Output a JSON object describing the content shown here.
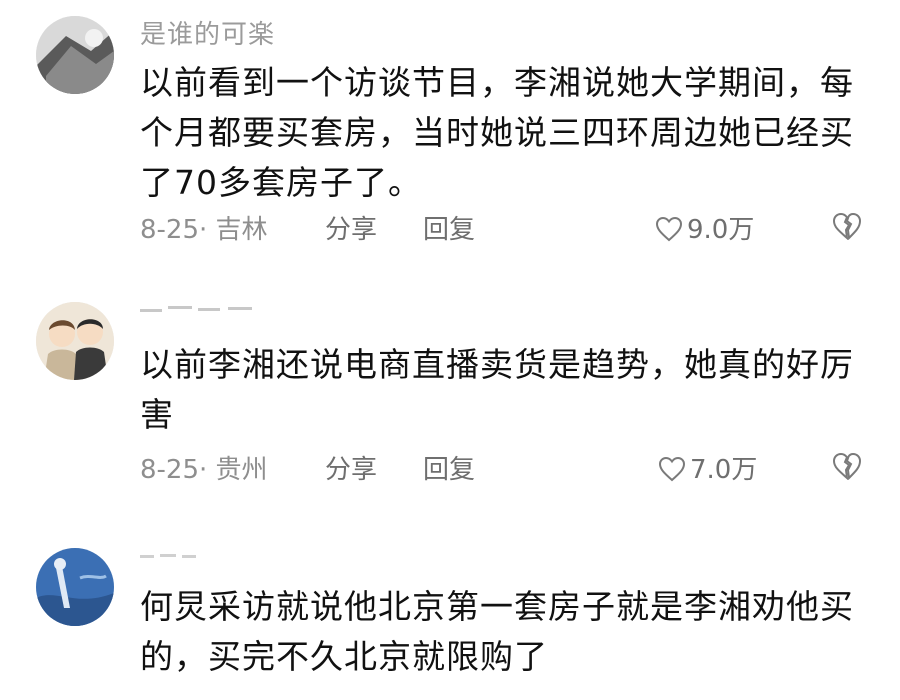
{
  "comments": [
    {
      "username": "是谁的可楽",
      "text": "以前看到一个访谈节目，李湘说她大学期间，每个月都要买套房，当时她说三四环周边她已经买了70多套房子了。",
      "date_location": "8-25· 吉林",
      "share_label": "分享",
      "reply_label": "回复",
      "likes": "9.0万"
    },
    {
      "username": "",
      "text": "以前李湘还说电商直播卖货是趋势，她真的好厉害",
      "date_location": "8-25· 贵州",
      "share_label": "分享",
      "reply_label": "回复",
      "likes": "7.0万"
    },
    {
      "username": "",
      "text": "何炅采访就说他北京第一套房子就是李湘劝他买的，买完不久北京就限购了",
      "date_location": "",
      "share_label": "",
      "reply_label": "",
      "likes": ""
    }
  ],
  "colors": {
    "text": "#111111",
    "meta": "#8e8e8e",
    "username": "#9b9b9b"
  },
  "icons": [
    "heart-outline-icon",
    "broken-heart-icon"
  ]
}
